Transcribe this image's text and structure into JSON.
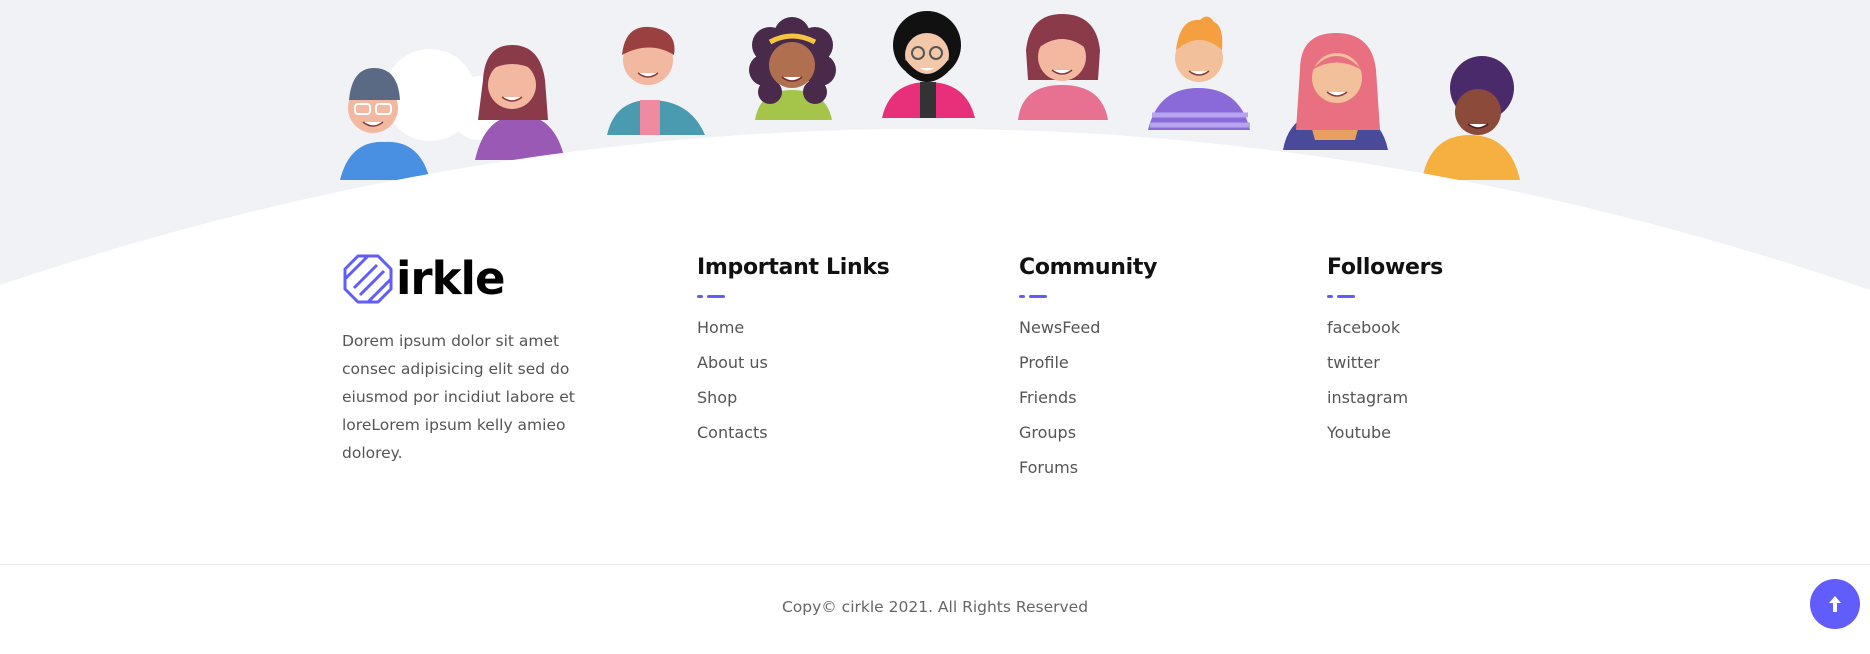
{
  "brand": {
    "logo_text": "irkle",
    "description": "Dorem ipsum dolor sit amet consec adipisicing elit sed do eiusmod por incidiut labore et loreLorem ipsum kelly amieo dolorey."
  },
  "columns": [
    {
      "title": "Important Links",
      "links": [
        "Home",
        "About us",
        "Shop",
        "Contacts"
      ]
    },
    {
      "title": "Community",
      "links": [
        "NewsFeed",
        "Profile",
        "Friends",
        "Groups",
        "Forums"
      ]
    },
    {
      "title": "Followers",
      "links": [
        "facebook",
        "twitter",
        "instagram",
        "Youtube"
      ]
    }
  ],
  "copyright": "Copy© cirkle 2021. All Rights Reserved",
  "scroll_top": {
    "icon": "arrow-up-icon"
  },
  "colors": {
    "accent": "#615dfa",
    "hero_bg": "#f0f2f6"
  }
}
